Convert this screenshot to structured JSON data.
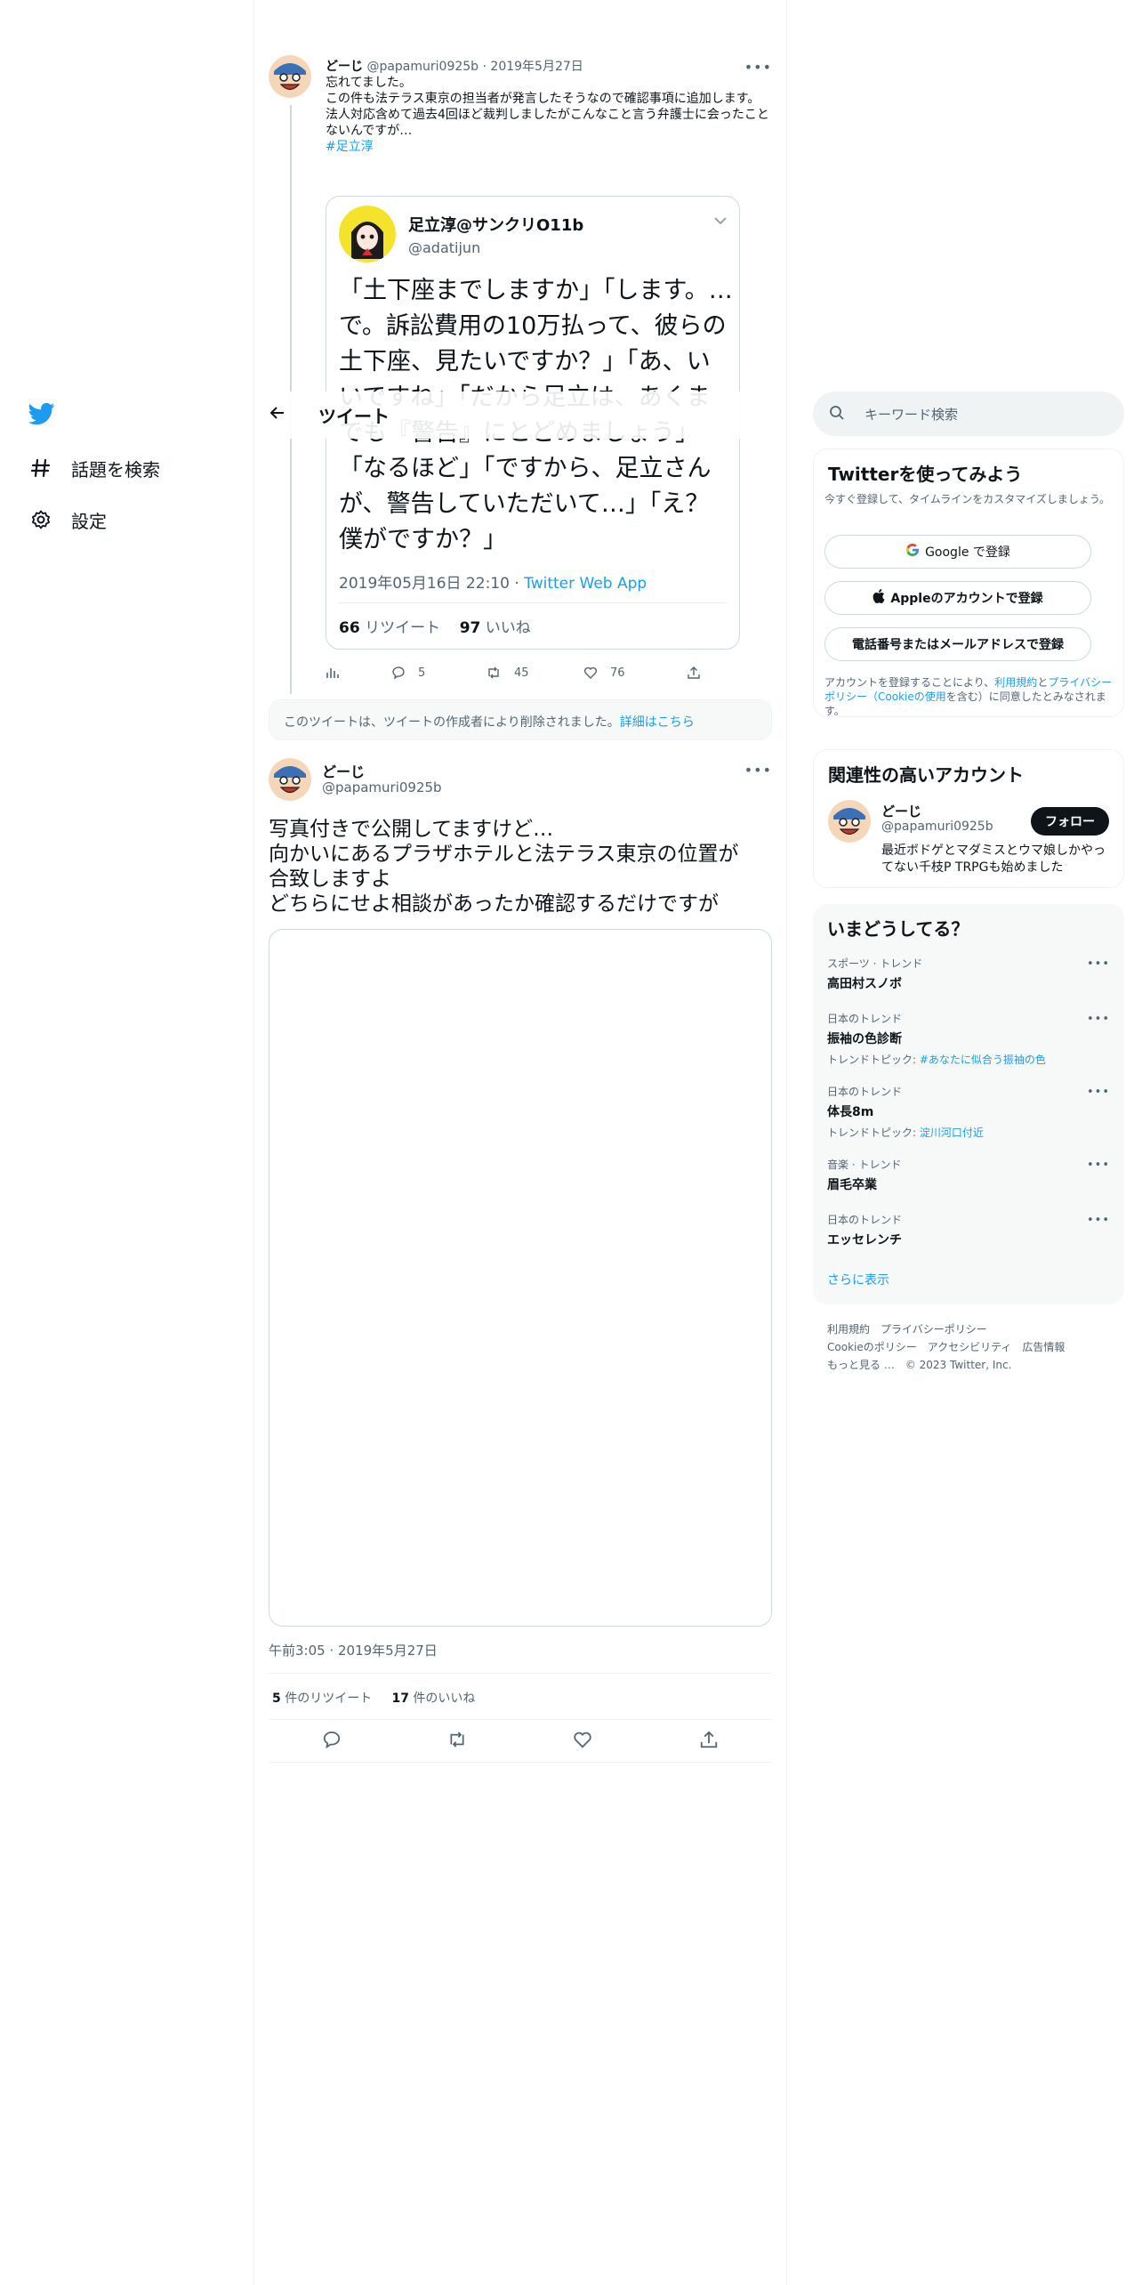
{
  "nav": {
    "items": [
      {
        "label": "話題を検索",
        "icon": "hashtag-icon"
      },
      {
        "label": "設定",
        "icon": "gear-icon"
      }
    ]
  },
  "header": {
    "title": "ツイート"
  },
  "quoted_tweet": {
    "name": "どーじ",
    "handle": "@papamuri0925b",
    "date": "2019年5月27日",
    "lines": [
      "忘れてました。",
      "この件も法テラス東京の担当者が発言したそうなので確認事項に追加します。",
      "法人対応含めて過去4回ほど裁判しましたがこんなこと言う弁護士に会ったことないんですが…",
      "#足立淳"
    ],
    "embed": {
      "name": "足立淳@サンクリO11b",
      "handle": "@adatijun",
      "text": "「土下座までしますか」「します。…で。訴訟費用の10万払って、彼らの土下座、見たいですか？」「あ、いいですね」「だから足立は、あくまでも『警告』にとどめましょう」「なるほど」「ですから、足立さんが、警告していただいて…」「え？　僕がですか？」",
      "date": "2019年05月16日 22:10",
      "via": "Twitter Web App",
      "retweets_count": "66",
      "retweets_label": "リツイート",
      "likes_count": "97",
      "likes_label": "いいね"
    },
    "replies": "5",
    "retweets": "45",
    "likes": "76"
  },
  "deleted_notice": {
    "text": "このツイートは、ツイートの作成者により削除されました。",
    "link": "詳細はこちら"
  },
  "focus_tweet": {
    "name": "どーじ",
    "handle": "@papamuri0925b",
    "lines": [
      "写真付きで公開してますけど…",
      "向かいにあるプラザホテルと法テラス東京の位置が",
      "合致しますよ",
      "どちらにせよ相談があったか確認するだけですが"
    ],
    "timestamp": "午前3:05 · 2019年5月27日",
    "retweets_count": "5",
    "retweets_label": "件のリツイート",
    "likes_count": "17",
    "likes_label": "件のいいね"
  },
  "search": {
    "placeholder": "キーワード検索"
  },
  "signup": {
    "title": "Twitterを使ってみよう",
    "subtitle": "今すぐ登録して、タイムラインをカスタマイズしましょう。",
    "google_button": "Google で登録",
    "apple_button": "Appleのアカウントで登録",
    "phone_button": "電話番号またはメールアドレスで登録",
    "terms_prefix": "アカウントを登録することにより、",
    "terms_link1": "利用規約",
    "terms_and": "と",
    "terms_link2": "プライバシーポリシー（Cookieの使用",
    "terms_suffix": "を含む）に同意したとみなされます。"
  },
  "related": {
    "title": "関連性の高いアカウント",
    "name": "どーじ",
    "handle": "@papamuri0925b",
    "bio": "最近ボドゲとマダミスとウマ娘しかやってない千枝P TRPGも始めました",
    "follow": "フォロー"
  },
  "trends": {
    "title": "いまどうしてる？",
    "items": [
      {
        "context": "スポーツ · トレンド",
        "name": "高田村スノボ",
        "topic_label": "",
        "topic": ""
      },
      {
        "context": "日本のトレンド",
        "name": "振袖の色診断",
        "topic_label": "トレンドトピック: ",
        "topic": "#あなたに似合う振袖の色"
      },
      {
        "context": "日本のトレンド",
        "name": "体長8m",
        "topic_label": "トレンドトピック: ",
        "topic": "淀川河口付近"
      },
      {
        "context": "音楽 · トレンド",
        "name": "眉毛卒業",
        "topic_label": "",
        "topic": ""
      },
      {
        "context": "日本のトレンド",
        "name": "エッセレンチ",
        "topic_label": "",
        "topic": ""
      }
    ],
    "show_more": "さらに表示"
  },
  "footer": {
    "links": [
      "利用規約",
      "プライバシーポリシー",
      "Cookieのポリシー",
      "アクセシビリティ",
      "広告情報",
      "もっと見る …",
      "© 2023 Twitter, Inc."
    ]
  },
  "colors": {
    "accent": "#1d9bf0",
    "text": "#0f1419",
    "muted": "#536471"
  }
}
